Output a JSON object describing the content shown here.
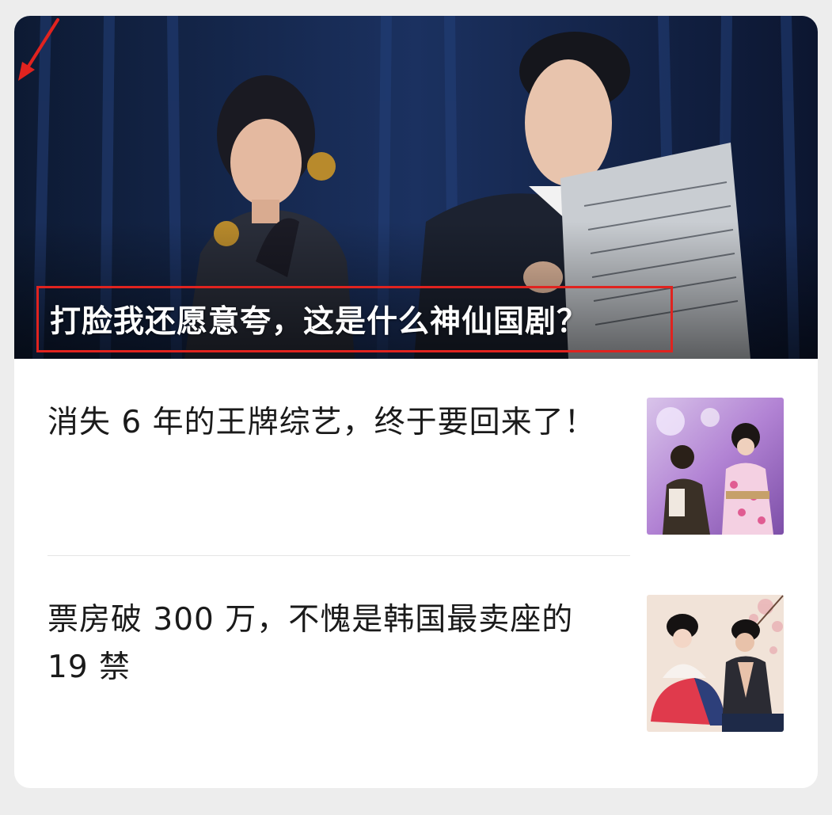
{
  "hero": {
    "title": "打脸我还愿意夸，这是什么神仙国剧？",
    "image": "two-characters-with-telephone-and-newspaper",
    "highlight_color": "#e0231f"
  },
  "articles": [
    {
      "title": "消失 6 年的王牌综艺，终于要回来了！",
      "thumbnail": "variety-show-stage-costumes"
    },
    {
      "title": "票房破 300 万，不愧是韩国最卖座的 19 禁",
      "thumbnail": "hanbok-couple-photo"
    }
  ]
}
